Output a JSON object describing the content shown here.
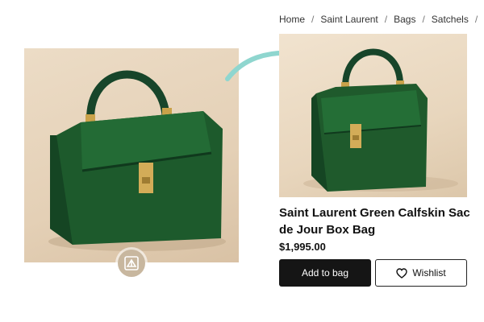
{
  "breadcrumb": [
    "Home",
    "Saint Laurent",
    "Bags",
    "Satchels"
  ],
  "product": {
    "title": "Saint Laurent Green Calfskin Sac de Jour Box Bag",
    "price": "$1,995.00"
  },
  "actions": {
    "add_to_bag": "Add to bag",
    "wishlist": "Wishlist"
  },
  "icons": {
    "lens": "visual-search-icon",
    "heart": "heart-icon",
    "arrow": "curved-arrow-icon"
  },
  "colors": {
    "bag_green": "#1f5a2c",
    "arrow": "#8fd6cf",
    "primary_button": "#151515"
  }
}
